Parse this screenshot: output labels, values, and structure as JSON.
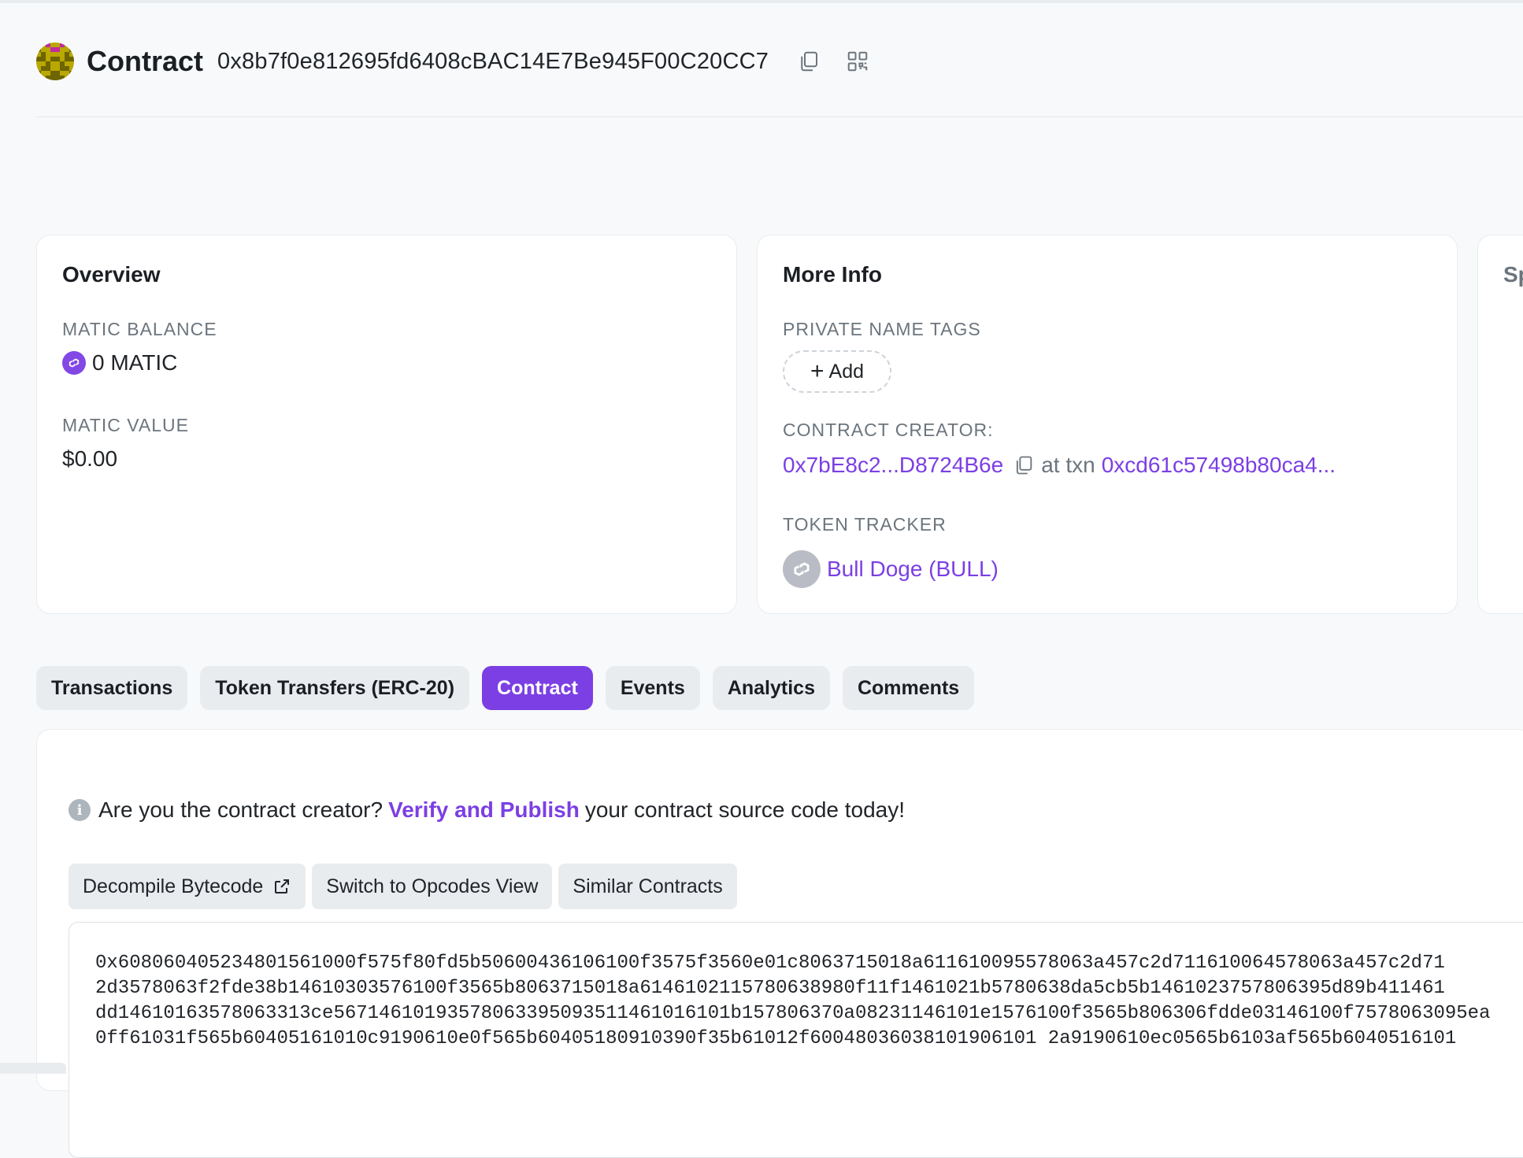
{
  "header": {
    "title": "Contract",
    "address": "0x8b7f0e812695fd6408cBAC14E7Be945F00C20CC7",
    "icons": [
      "copy-icon",
      "qr-code-icon"
    ]
  },
  "overview": {
    "title": "Overview",
    "balance_label": "MATIC BALANCE",
    "balance_value": "0 MATIC",
    "value_label": "MATIC VALUE",
    "value_amount": "$0.00"
  },
  "more_info": {
    "title": "More Info",
    "private_tags_label": "PRIVATE NAME TAGS",
    "add_label": "Add",
    "creator_label": "CONTRACT CREATOR:",
    "creator_address": "0x7bE8c2...D8724B6e",
    "at_txn_text": "at txn",
    "creator_txn": "0xcd61c57498b80ca4...",
    "token_tracker_label": "TOKEN TRACKER",
    "token_name": "Bull Doge (BULL)"
  },
  "third_card": {
    "partial_title": "Sp"
  },
  "tabs": [
    {
      "label": "Transactions",
      "active": false
    },
    {
      "label": "Token Transfers (ERC-20)",
      "active": false
    },
    {
      "label": "Contract",
      "active": true
    },
    {
      "label": "Events",
      "active": false
    },
    {
      "label": "Analytics",
      "active": false
    },
    {
      "label": "Comments",
      "active": false
    }
  ],
  "contract": {
    "notice_prefix": "Are you the contract creator?",
    "notice_link": "Verify and Publish",
    "notice_suffix": "your contract source code today!",
    "buttons": {
      "decompile": "Decompile Bytecode",
      "opcodes": "Switch to Opcodes View",
      "similar": "Similar Contracts"
    },
    "bytecode_lines": [
      "0x608060405234801561000f575f80fd5b50600436106100f3575f3560e01c8063715018a611610095578063a457c2d711610064578063a457c2d71",
      "2d3578063f2fde38b14610303576100f3565b8063715018a6146102115780638980f11f1461021b5780638da5cb5b1461023757806395d89b411461",
      "dd14610163578063313ce56714610193578063395093511461016101b157806370a08231146101e1576100f3565b806306fdde03146100f7578063095ea",
      "0ff61031f565b60405161010c9190610e0f565b60405180910390f35b61012f60048036038101906101 2a9190610ec0565b6103af565b6040516101"
    ]
  },
  "colors": {
    "accent": "#7b3fe4",
    "matic": "#8247e5",
    "muted": "#6c757d",
    "tab_bg": "#e9ecef"
  }
}
